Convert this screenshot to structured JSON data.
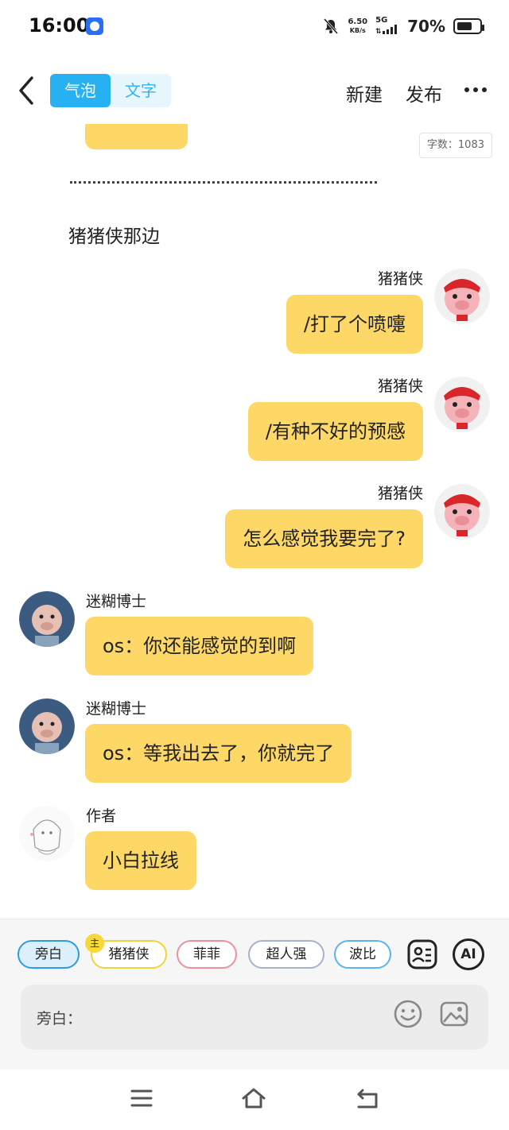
{
  "status_bar": {
    "time": "16:00",
    "net_speed": "6.50",
    "net_speed_unit": "KB/s",
    "network": "5G",
    "battery": "70%",
    "battery_level": 0.7
  },
  "header": {
    "toggle_bubble": "气泡",
    "toggle_text": "文字",
    "new_label": "新建",
    "publish_label": "发布"
  },
  "word_count": "字数：1083",
  "chat": {
    "narration": "猪猪侠那边",
    "messages": [
      {
        "speaker": "猪猪侠",
        "text": "/打了个喷嚏",
        "side": "right"
      },
      {
        "speaker": "猪猪侠",
        "text": "/有种不好的预感",
        "side": "right"
      },
      {
        "speaker": "猪猪侠",
        "text": "怎么感觉我要完了?",
        "side": "right"
      },
      {
        "speaker": "迷糊博士",
        "text": "os：你还能感觉的到啊",
        "side": "left"
      },
      {
        "speaker": "迷糊博士",
        "text": "os：等我出去了，你就完了",
        "side": "left"
      },
      {
        "speaker": "作者",
        "text": "小白拉线",
        "side": "left"
      }
    ]
  },
  "characters": {
    "narration": "旁白",
    "main_badge": "主",
    "pig": "猪猪侠",
    "fei": "菲菲",
    "chao": "超人强",
    "bo": "波比"
  },
  "tools": {
    "ai": "AI"
  },
  "input": {
    "label": "旁白："
  },
  "colors": {
    "bubble": "#fdd867",
    "accent": "#27b1f2"
  }
}
